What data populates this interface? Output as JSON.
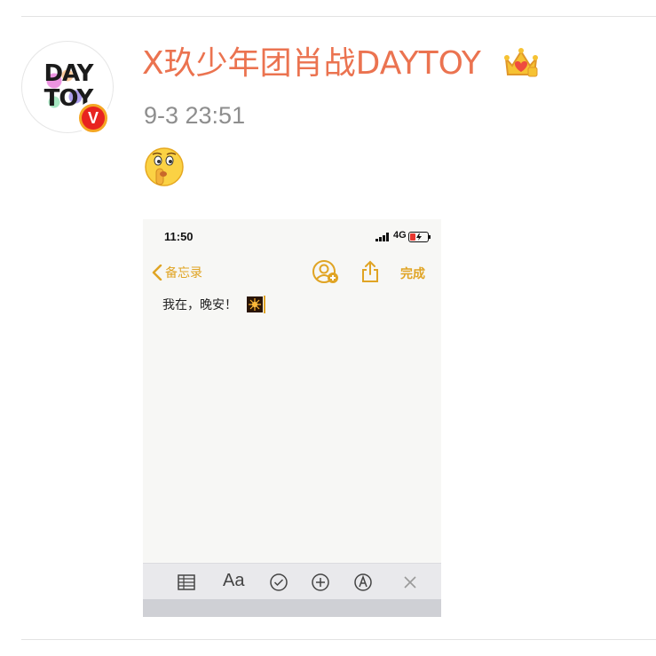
{
  "post": {
    "username": "X玖少年团肖战DAYTOY",
    "timestamp": "9-3 23:51",
    "avatar_text_line1": "DAY",
    "avatar_text_line2": "TOY",
    "verified_badge": "V",
    "badge_icon": "crown-icon",
    "content_emoji": "shushing-face"
  },
  "phone": {
    "status_time": "11:50",
    "network": "4G",
    "nav": {
      "back_label": "备忘录",
      "done_label": "完成"
    },
    "note_text": "我在，晚安！",
    "note_emoji": "fireworks",
    "toolbar": {
      "format_label": "Aa"
    }
  },
  "colors": {
    "username": "#eb7350",
    "accent": "#e0a424",
    "timestamp": "#8e8e8e"
  }
}
